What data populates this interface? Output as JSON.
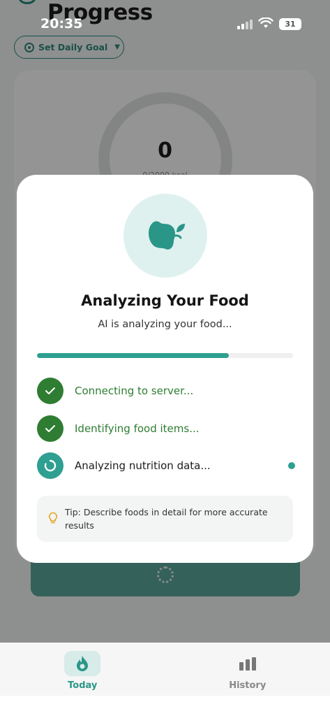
{
  "status_bar": {
    "time": "20:35",
    "battery": "31"
  },
  "background": {
    "title": "Progress",
    "goal_button_label": "Set Daily Goal",
    "calorie_value": "0",
    "calorie_subtitle": "0/2000 kcal"
  },
  "modal": {
    "title": "Analyzing Your Food",
    "subtitle": "AI is analyzing your food...",
    "progress": 0.75,
    "steps": [
      {
        "label": "Connecting to server...",
        "state": "done"
      },
      {
        "label": "Identifying food items...",
        "state": "done"
      },
      {
        "label": "Analyzing nutrition data...",
        "state": "active"
      }
    ],
    "tip": "Tip: Describe foods in detail for more accurate results"
  },
  "tab_bar": {
    "tabs": [
      {
        "label": "Today",
        "icon": "flame-icon",
        "active": true
      },
      {
        "label": "History",
        "icon": "bar-chart-icon",
        "active": false
      }
    ]
  },
  "colors": {
    "accent": "#2e9f90",
    "done_green": "#2e7d32",
    "food_circle_bg": "#dff1ef"
  }
}
